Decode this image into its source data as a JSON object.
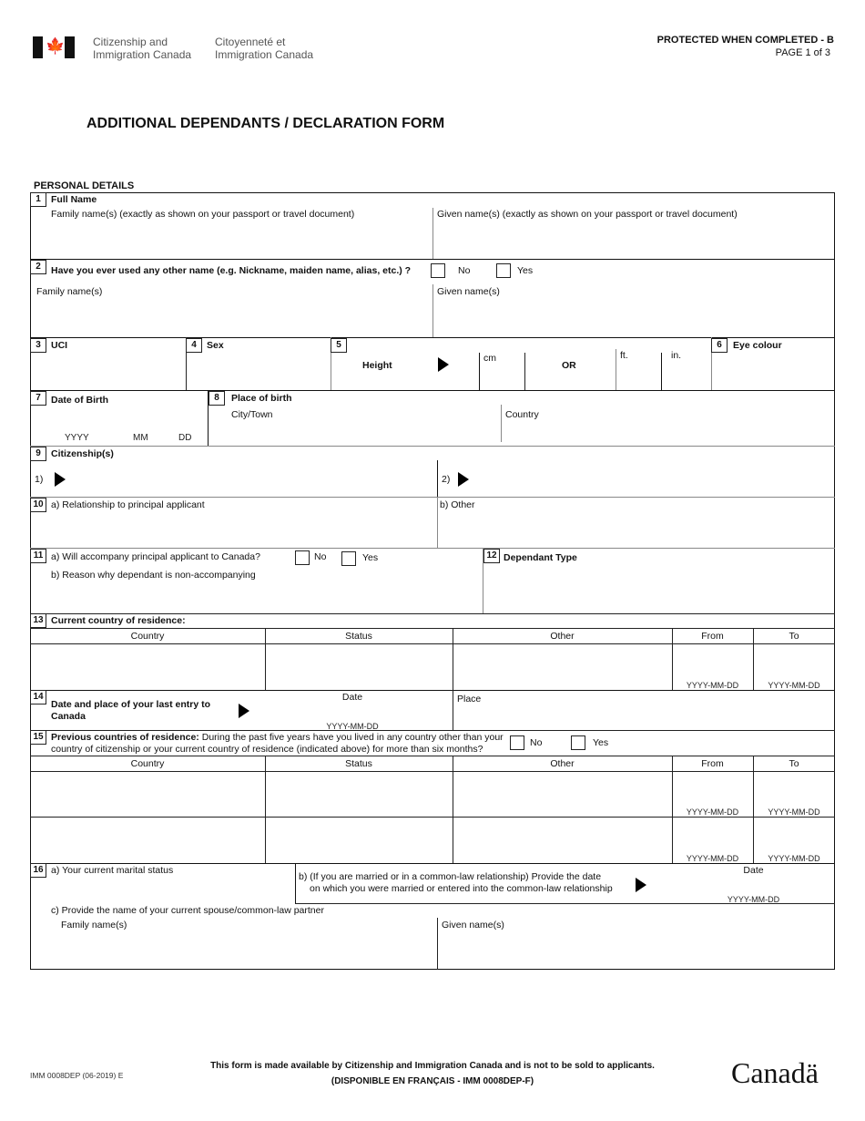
{
  "header": {
    "org_en_line1": "Citizenship and",
    "org_en_line2": "Immigration Canada",
    "org_fr_line1": "Citoyenneté et",
    "org_fr_line2": "Immigration Canada",
    "protected": "PROTECTED WHEN COMPLETED - B",
    "page": "PAGE 1 of 3",
    "flag_icon": "canada-flag-icon"
  },
  "title": "ADDITIONAL DEPENDANTS / DECLARATION FORM",
  "section_title": "PERSONAL DETAILS",
  "q1": {
    "num": "1",
    "label": "Full Name",
    "family": "Family name(s)  (exactly as shown on your passport or travel document)",
    "given": "Given name(s)  (exactly as shown on your passport or travel document)"
  },
  "q2": {
    "num": "2",
    "label": "Have you ever used any other name (e.g. Nickname, maiden name, alias, etc.) ?",
    "no": "No",
    "yes": "Yes",
    "family": "Family name(s)",
    "given": "Given name(s)"
  },
  "q3": {
    "num": "3",
    "label": "UCI"
  },
  "q4": {
    "num": "4",
    "label": "Sex"
  },
  "q5": {
    "num": "5",
    "label": "Height",
    "cm": "cm",
    "or": "OR",
    "ft": "ft.",
    "in": "in."
  },
  "q6": {
    "num": "6",
    "label": "Eye colour"
  },
  "q7": {
    "num": "7",
    "label": "Date of Birth",
    "yyyy": "YYYY",
    "mm": "MM",
    "dd": "DD"
  },
  "q8": {
    "num": "8",
    "label": "Place of birth",
    "city": "City/Town",
    "country": "Country"
  },
  "q9": {
    "num": "9",
    "label": "Citizenship(s)",
    "first": "1)",
    "second": "2)"
  },
  "q10": {
    "num": "10",
    "a": "a) Relationship to principal applicant",
    "b": "b) Other"
  },
  "q11": {
    "num": "11",
    "a": "a) Will accompany principal applicant to Canada?",
    "no": "No",
    "yes": "Yes",
    "b": "b) Reason why dependant is non-accompanying"
  },
  "q12": {
    "num": "12",
    "label": "Dependant Type"
  },
  "q13": {
    "num": "13",
    "label": "Current country of residence:",
    "columns": [
      "Country",
      "Status",
      "Other",
      "From",
      "To"
    ],
    "date_hint": "YYYY-MM-DD"
  },
  "q14": {
    "num": "14",
    "label_line1": "Date and place of your last entry to",
    "label_line2": "Canada",
    "date": "Date",
    "date_hint": "YYYY-MM-DD",
    "place": "Place"
  },
  "q15": {
    "num": "15",
    "label_bold": "Previous countries of residence:",
    "label_rest": " During the past five years have you lived in any country other than your",
    "label_line2": "country of citizenship or your current country of residence (indicated above) for more than six months?",
    "no": "No",
    "yes": "Yes",
    "columns": [
      "Country",
      "Status",
      "Other",
      "From",
      "To"
    ],
    "date_hint": "YYYY-MM-DD"
  },
  "q16": {
    "num": "16",
    "a": "a) Your current marital status",
    "b_line1": "b) (If you are married or in a common-law relationship) Provide the date",
    "b_line2": "on which you were married or entered into the common-law relationship",
    "date": "Date",
    "date_hint": "YYYY-MM-DD",
    "c": "c) Provide the name of your current spouse/common-law partner",
    "family": "Family name(s)",
    "given": "Given name(s)"
  },
  "footer": {
    "code": "IMM 0008DEP (06-2019) E",
    "notice": "This form is made available by Citizenship and Immigration Canada and is not to be sold to applicants.",
    "french": "(DISPONIBLE EN FRANÇAIS - IMM 0008DEP-F)",
    "wordmark": "Canadä"
  }
}
